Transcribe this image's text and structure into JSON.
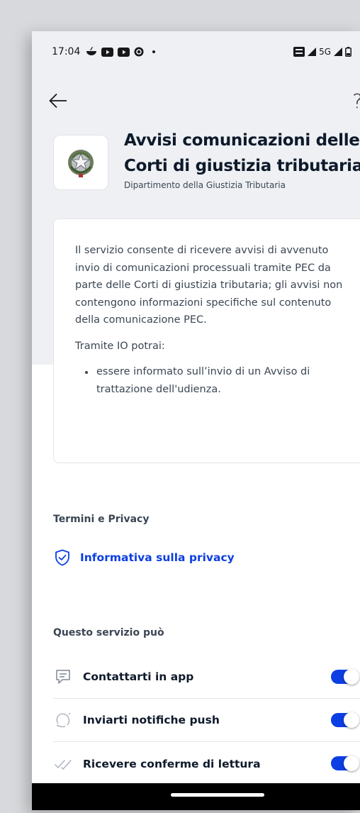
{
  "status_bar": {
    "time": "17:04",
    "network": "5G"
  },
  "header": {
    "title_line1": "Avvisi comunicazioni delle",
    "title_line2": "Corti di giustizia tributaria",
    "subtitle": "Dipartimento della Giustizia Tributaria",
    "logo_icon": "emblem-icon"
  },
  "description": {
    "intro": "Il servizio consente di ricevere avvisi di avvenuto invio di comunicazioni processuali tramite PEC da parte delle Corti di giustizia tributaria; gli avvisi non contengono informazioni specifiche sul contenuto della comunicazione PEC.",
    "lead": "Tramite IO potrai:",
    "items": [
      "essere informato sull’invio di un Avviso di trattazione dell'udienza."
    ]
  },
  "terms": {
    "section_title": "Termini e Privacy",
    "privacy_link": "Informativa sulla privacy"
  },
  "capabilities": {
    "section_title": "Questo servizio può",
    "items": [
      {
        "label": "Contattarti in app",
        "icon": "message-icon",
        "enabled": true
      },
      {
        "label": "Inviarti notifiche push",
        "icon": "bell-icon",
        "enabled": true
      },
      {
        "label": "Ricevere conferme di lettura",
        "icon": "double-check-icon",
        "enabled": true
      }
    ]
  },
  "colors": {
    "accent": "#0b3ee3",
    "background_top": "#eef0f3",
    "text_primary": "#0e1a2b",
    "text_secondary": "#3b4654"
  }
}
